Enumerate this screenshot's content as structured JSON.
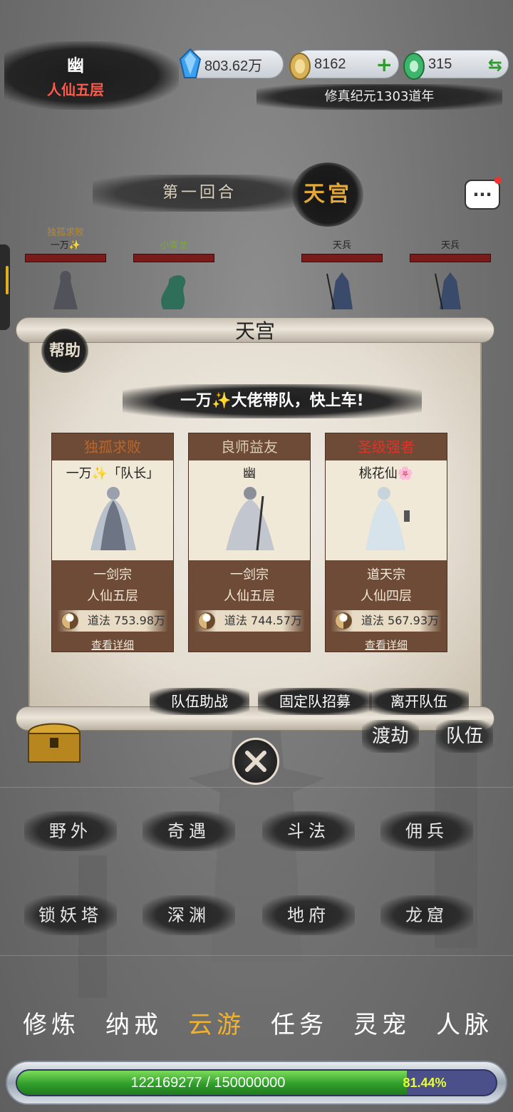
{
  "player": {
    "name": "幽",
    "rank": "人仙五层"
  },
  "currencies": [
    {
      "icon": "blue-crystal-icon",
      "value": "803.62万",
      "color": "#3aa0f0"
    },
    {
      "icon": "gold-coin-icon",
      "value": "8162",
      "action": "+",
      "color": "#d8b25a"
    },
    {
      "icon": "jade-icon",
      "value": "315",
      "action": "⇆",
      "color": "#3db56a"
    }
  ],
  "era": "修真纪元1303道年",
  "battle": {
    "round": "第一回合",
    "realm": "天宫",
    "fighters": [
      {
        "title": "独孤求败",
        "name": "一万✨"
      },
      {
        "title": "",
        "name": "小青龙"
      },
      {
        "title": "",
        "name": "天兵"
      },
      {
        "title": "",
        "name": "天兵"
      }
    ]
  },
  "dialog": {
    "title": "天宫",
    "help_label": "帮助",
    "slogan": "一万✨大佬带队，快上车!",
    "members": [
      {
        "title": "独孤求败",
        "name": "一万✨「队长」",
        "sect": "一剑宗",
        "realm": "人仙五层",
        "dao": "道法 753.98万",
        "detail": "查看详细"
      },
      {
        "title": "良师益友",
        "name": "幽",
        "sect": "一剑宗",
        "realm": "人仙五层",
        "dao": "道法 744.57万",
        "detail": ""
      },
      {
        "title": "圣级强者",
        "name": "桃花仙🌸",
        "sect": "道天宗",
        "realm": "人仙四层",
        "dao": "道法 567.93万",
        "detail": "查看详细"
      }
    ],
    "buttons": [
      "队伍助战",
      "固定队招募",
      "离开队伍"
    ]
  },
  "side_buttons": [
    "渡劫",
    "队伍"
  ],
  "locations": [
    "野外",
    "奇遇",
    "斗法",
    "佣兵",
    "锁妖塔",
    "深渊",
    "地府",
    "龙窟"
  ],
  "nav": [
    "修炼",
    "纳戒",
    "云游",
    "任务",
    "灵宠",
    "人脉"
  ],
  "nav_active": "云游",
  "exp": {
    "text": "122169277 / 150000000",
    "percent": "81.44%",
    "fraction": 0.8144
  }
}
